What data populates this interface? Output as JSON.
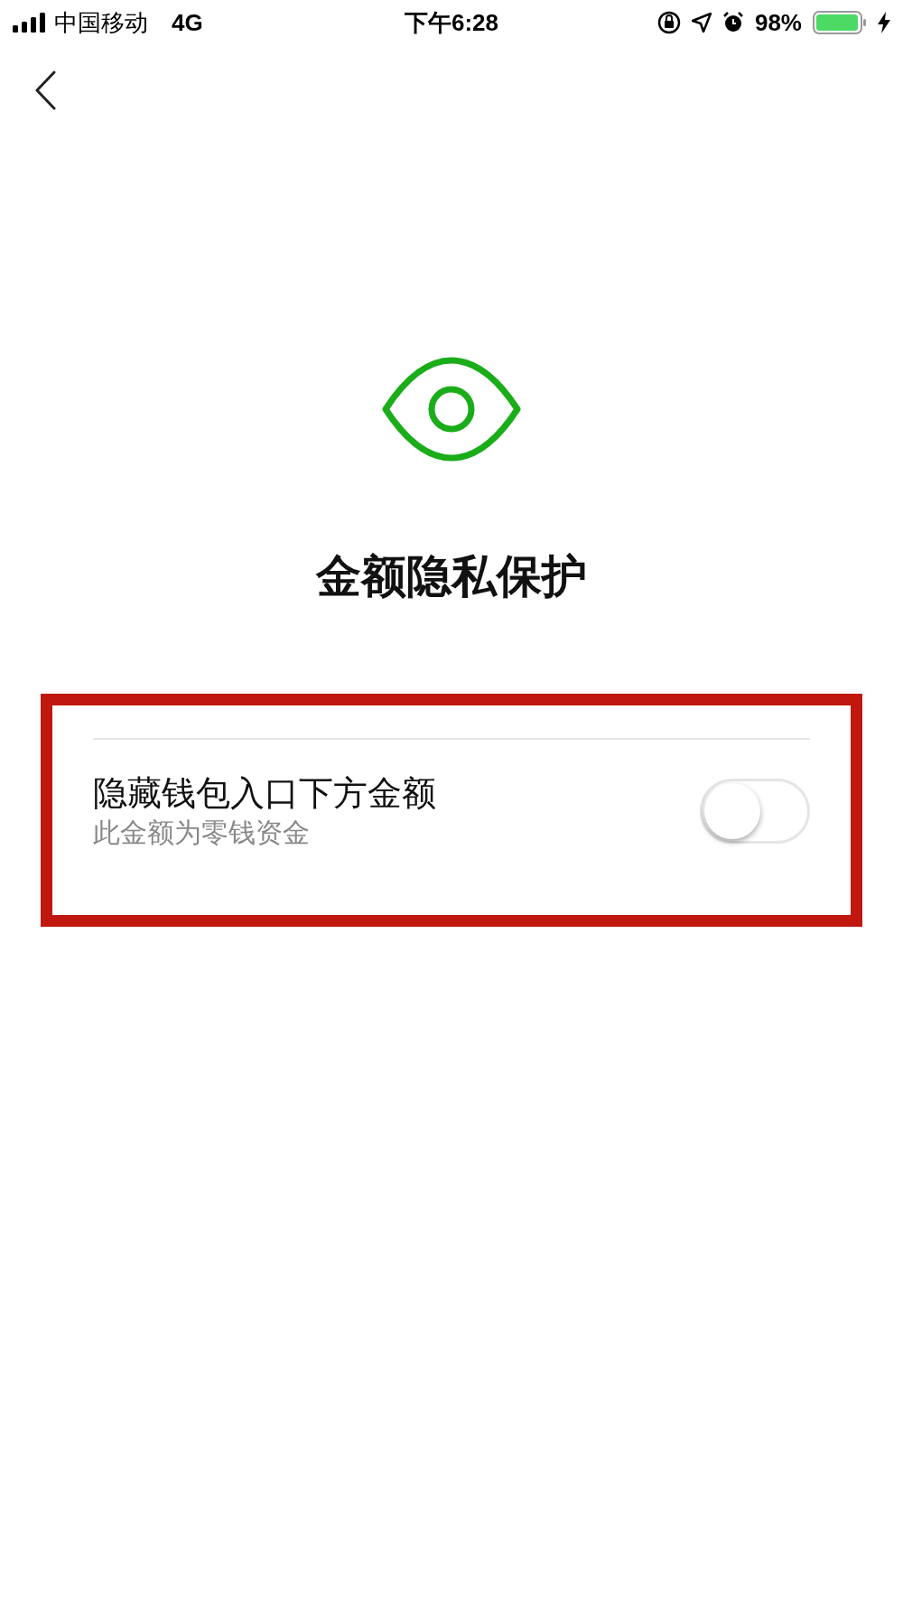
{
  "status_bar": {
    "carrier": "中国移动",
    "network": "4G",
    "time": "下午6:28",
    "battery": "98%"
  },
  "title": "金额隐私保护",
  "setting": {
    "label": "隐藏钱包入口下方金额",
    "description": "此金额为零钱资金",
    "on": false
  }
}
